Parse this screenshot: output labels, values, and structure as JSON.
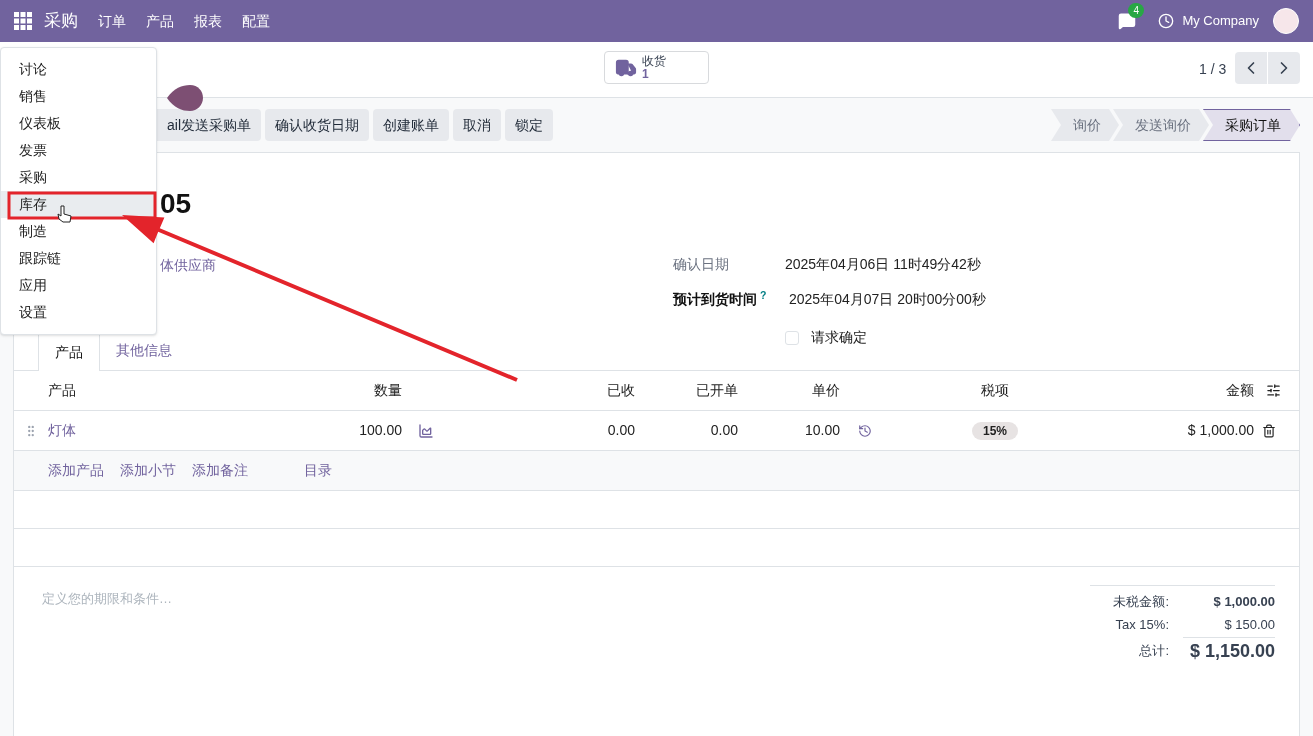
{
  "navbar": {
    "app": "采购",
    "menus": [
      "订单",
      "产品",
      "报表",
      "配置"
    ],
    "messages_badge": "4",
    "company": "My Company"
  },
  "control_panel": {
    "smart_button": {
      "label": "收货",
      "count": "1"
    },
    "pager": "1 / 3"
  },
  "actions": [
    "ail发送采购单",
    "确认收货日期",
    "创建账单",
    "取消",
    "锁定"
  ],
  "statusbar": [
    {
      "label": "询价",
      "selected": false
    },
    {
      "label": "发送询价",
      "selected": false
    },
    {
      "label": "采购订单",
      "selected": true
    }
  ],
  "form": {
    "title": "05",
    "vendor": "体供应商",
    "fields": [
      {
        "label": "确认日期",
        "value": "2025年04月06日 11时49分42秒",
        "bold": false
      },
      {
        "label": "预计到货时间",
        "value": "2025年04月07日 20时00分00秒",
        "bold": true,
        "tooltip": "?"
      }
    ],
    "checkbox": {
      "label": "请求确定",
      "checked": false
    }
  },
  "tabs": [
    {
      "label": "产品",
      "selected": true
    },
    {
      "label": "其他信息",
      "selected": false
    }
  ],
  "table": {
    "columns": [
      "产品",
      "数量",
      "已收",
      "已开单",
      "单价",
      "税项",
      "金额"
    ],
    "rows": [
      {
        "product": "灯体",
        "quantity": "100.00",
        "received": "0.00",
        "billed": "0.00",
        "unit_price": "10.00",
        "tax": "15%",
        "amount": "$ 1,000.00"
      }
    ],
    "add_links": [
      "添加产品",
      "添加小节",
      "添加备注",
      "目录"
    ]
  },
  "terms_placeholder": "定义您的期限和条件…",
  "totals": [
    {
      "label": "未税金额:",
      "value": "$ 1,000.00",
      "kind": "subtotal"
    },
    {
      "label": "Tax 15%:",
      "value": "$ 150.00",
      "kind": "tax"
    },
    {
      "label": "总计:",
      "value": "$ 1,150.00",
      "kind": "total"
    }
  ],
  "app_menu": {
    "items": [
      {
        "label": "讨论",
        "selected": false
      },
      {
        "label": "销售",
        "selected": false
      },
      {
        "label": "仪表板",
        "selected": false
      },
      {
        "label": "发票",
        "selected": false
      },
      {
        "label": "采购",
        "selected": false
      },
      {
        "label": "库存",
        "selected": true
      },
      {
        "label": "制造",
        "selected": false
      },
      {
        "label": "跟踪链",
        "selected": false
      },
      {
        "label": "应用",
        "selected": false
      },
      {
        "label": "设置",
        "selected": false
      }
    ]
  }
}
